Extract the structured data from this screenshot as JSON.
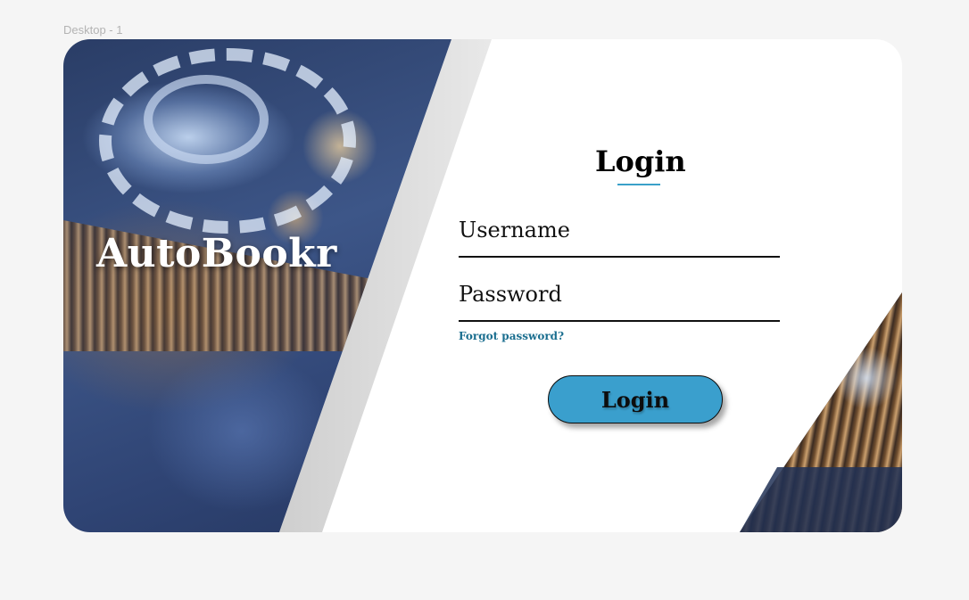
{
  "canvas": {
    "frame_label": "Desktop - 1"
  },
  "brand": {
    "name": "AutoBookr"
  },
  "login_form": {
    "title": "Login",
    "username_label": "Username",
    "username_value": "",
    "password_label": "Password",
    "password_value": "",
    "forgot_password": "Forgot password?",
    "submit_label": "Login"
  },
  "colors": {
    "background": "#f5f5f5",
    "card": "#ffffff",
    "accent": "#3a9fcd",
    "link": "#1a6e8f",
    "underline_accent": "#3aa0c9"
  },
  "icons": {
    "left_hero": "gear-image",
    "right_hero": "gear-image"
  }
}
